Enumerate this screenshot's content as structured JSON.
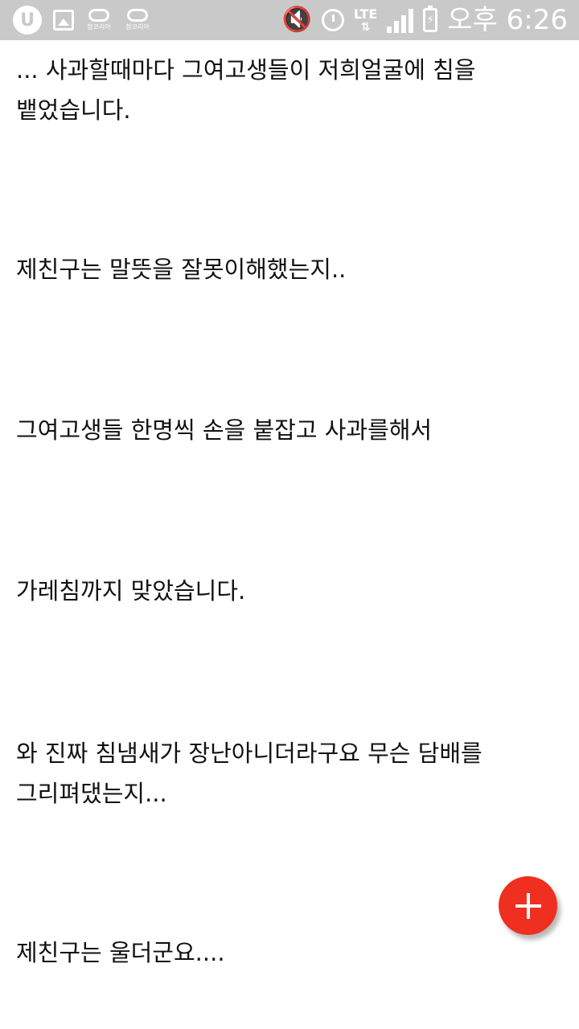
{
  "status_bar": {
    "app_u_label": "U",
    "app1_label": "참코리아",
    "app2_label": "참코리아",
    "network_label": "LTE",
    "network_arrows": "⇅",
    "time": "오후 6:26"
  },
  "article": {
    "paragraphs": [
      "... 사과할때마다 그여고생들이 저희얼굴에 침을 뱉었습니다.",
      "제친구는 말뜻을 잘못이해했는지..",
      "그여고생들 한명씩 손을 붙잡고 사과를해서",
      "가레침까지 맞았습니다.",
      "와 진짜 침냄새가 장난아니더라구요 무슨 담배를 그리펴댔는지...",
      "제친구는 울더군요...."
    ]
  },
  "colors": {
    "status_bar_bg": "#c9c9c9",
    "fab": "#ef2f1f",
    "text": "#111111"
  },
  "icons": {
    "fab": "plus-icon"
  }
}
